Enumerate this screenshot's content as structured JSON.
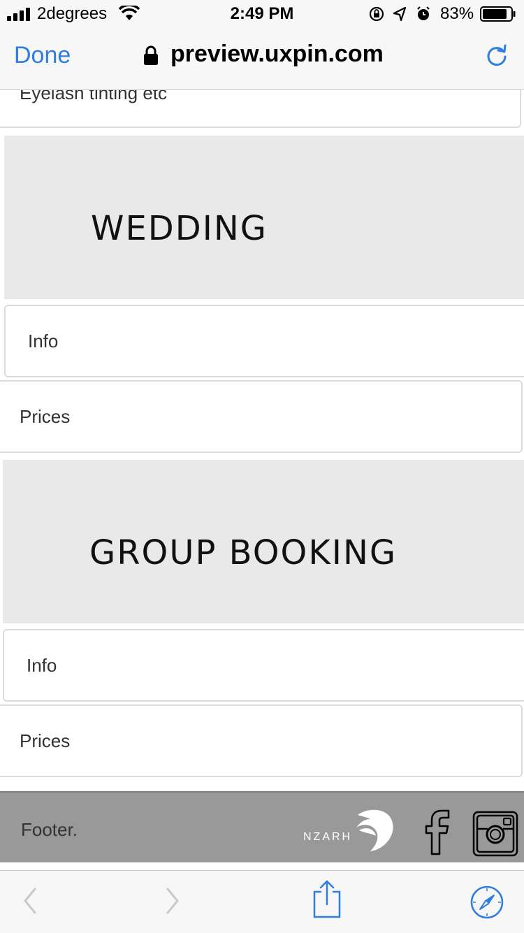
{
  "status_bar": {
    "carrier": "2degrees",
    "time": "2:49 PM",
    "battery_pct": "83%",
    "battery_level": 0.83
  },
  "url_bar": {
    "done_label": "Done",
    "url": "preview.uxpin.com"
  },
  "content": {
    "partial_card_text": "Eyelash tinting etc",
    "sections": [
      {
        "title": "WEDDING",
        "items": [
          "Info",
          "Prices"
        ]
      },
      {
        "title": "GROUP BOOKING",
        "items": [
          "Info",
          "Prices"
        ]
      }
    ],
    "footer": {
      "text": "Footer.",
      "logo_text": "NZARH"
    }
  },
  "colors": {
    "accent": "#2f7de1",
    "section_bg": "#e9e9e9",
    "footer_bg": "#999999"
  },
  "icons": [
    "signal-icon",
    "wifi-icon",
    "orientation-lock-icon",
    "location-icon",
    "alarm-icon",
    "battery-icon",
    "lock-icon",
    "reload-icon",
    "facebook-icon",
    "instagram-icon",
    "back-icon",
    "forward-icon",
    "share-icon",
    "safari-compass-icon"
  ]
}
